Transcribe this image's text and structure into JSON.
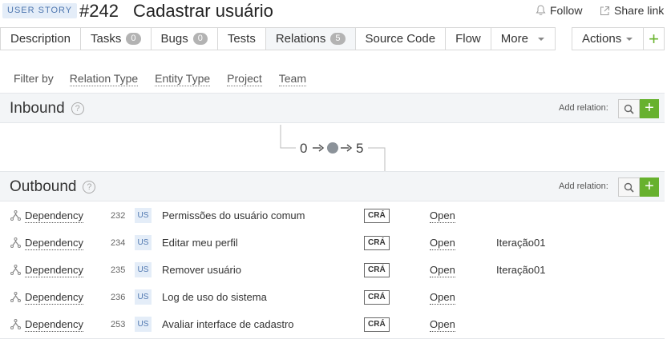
{
  "header": {
    "type_badge": "USER STORY",
    "id": "#242",
    "title": "Cadastrar usuário",
    "follow": "Follow",
    "share": "Share link"
  },
  "tabs": [
    {
      "label": "Description"
    },
    {
      "label": "Tasks",
      "count": "0"
    },
    {
      "label": "Bugs",
      "count": "0"
    },
    {
      "label": "Tests"
    },
    {
      "label": "Relations",
      "count": "5",
      "active": true
    },
    {
      "label": "Source Code"
    },
    {
      "label": "Flow"
    },
    {
      "label": "More"
    }
  ],
  "actions_label": "Actions",
  "filters": {
    "label": "Filter by",
    "items": [
      "Relation Type",
      "Entity Type",
      "Project",
      "Team"
    ]
  },
  "inbound": {
    "title": "Inbound",
    "add_relation": "Add relation:"
  },
  "graph": {
    "inbound_count": "0",
    "outbound_count": "5"
  },
  "outbound": {
    "title": "Outbound",
    "add_relation": "Add relation:",
    "rows": [
      {
        "type": "Dependency",
        "id": "232",
        "entity": "US",
        "name": "Permissões do usuário comum",
        "abbr": "CRÁ",
        "state": "Open",
        "iteration": ""
      },
      {
        "type": "Dependency",
        "id": "234",
        "entity": "US",
        "name": "Editar meu perfil",
        "abbr": "CRÁ",
        "state": "Open",
        "iteration": "Iteração01"
      },
      {
        "type": "Dependency",
        "id": "235",
        "entity": "US",
        "name": "Remover usuário",
        "abbr": "CRÁ",
        "state": "Open",
        "iteration": "Iteração01"
      },
      {
        "type": "Dependency",
        "id": "236",
        "entity": "US",
        "name": "Log de uso do sistema",
        "abbr": "CRÁ",
        "state": "Open",
        "iteration": ""
      },
      {
        "type": "Dependency",
        "id": "253",
        "entity": "US",
        "name": "Avaliar interface de cadastro",
        "abbr": "CRÁ",
        "state": "Open",
        "iteration": ""
      }
    ]
  },
  "colors": {
    "accent_green": "#67b12e",
    "badge_bg": "#e4edf8",
    "badge_text": "#4f77b0"
  }
}
